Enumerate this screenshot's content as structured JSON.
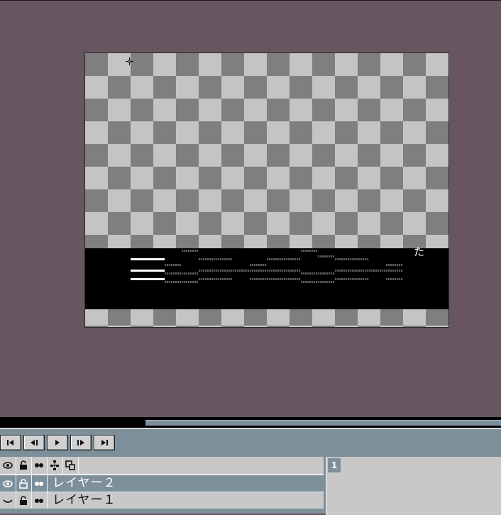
{
  "canvas": {
    "band_glyph": "た"
  },
  "timeline": {
    "transport": [
      {
        "name": "first-frame-button",
        "icon": "first-frame-icon"
      },
      {
        "name": "prev-frame-button",
        "icon": "prev-frame-icon"
      },
      {
        "name": "play-button",
        "icon": "play-icon"
      },
      {
        "name": "next-frame-button",
        "icon": "next-frame-icon"
      },
      {
        "name": "last-frame-button",
        "icon": "last-frame-icon"
      }
    ],
    "frame_number": "1",
    "layers": [
      {
        "name": "レイヤー２",
        "selected": true
      },
      {
        "name": "レイヤー１",
        "selected": false
      }
    ]
  },
  "colors": {
    "workspace": "#675560",
    "timeline": "#7d8f9b",
    "panel": "#c8c8c8"
  }
}
